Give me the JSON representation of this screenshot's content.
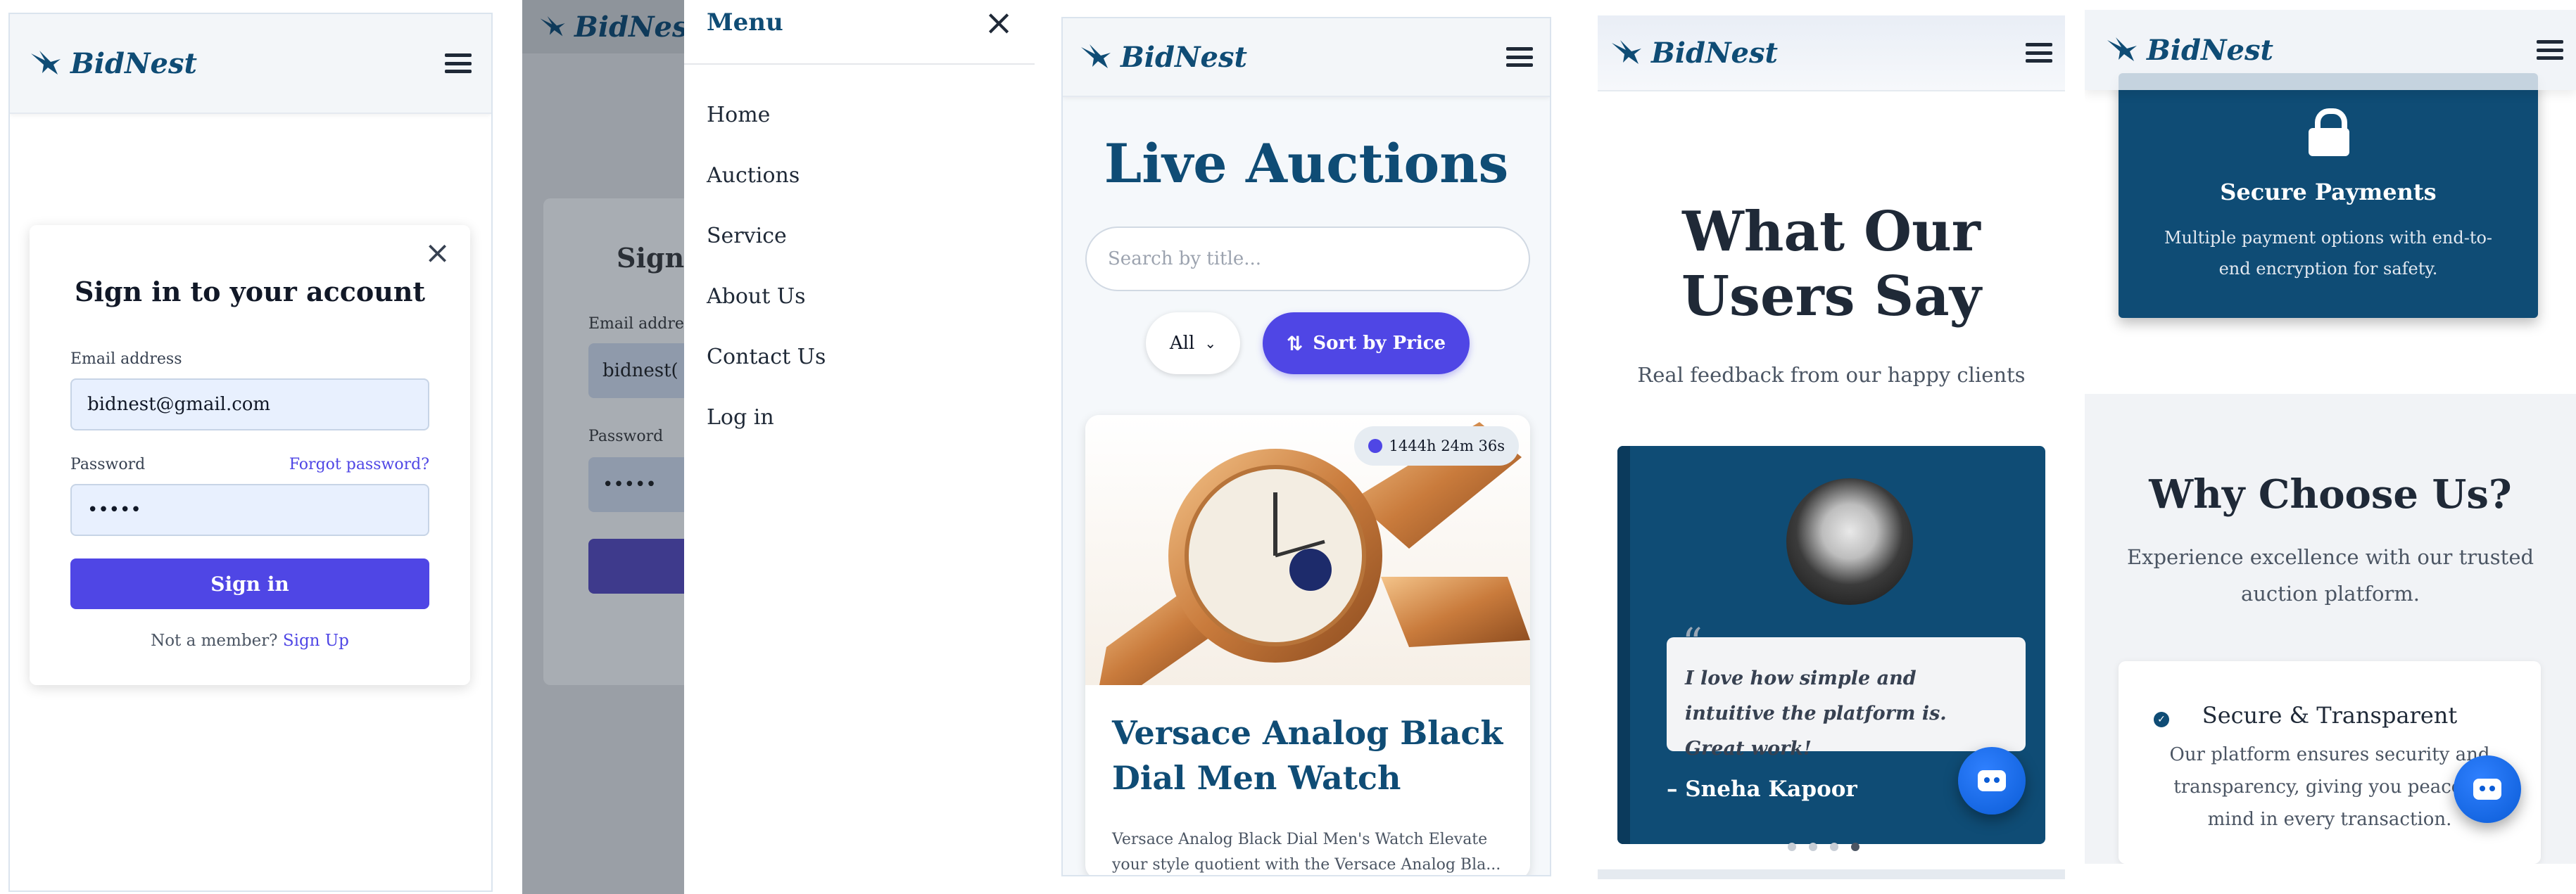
{
  "brand": {
    "name": "BidNest"
  },
  "signin": {
    "title": "Sign in to your account",
    "email_label": "Email address",
    "email_value": "bidnest@gmail.com",
    "password_label": "Password",
    "forgot": "Forgot password?",
    "password_value": "•••••",
    "submit": "Sign in",
    "member_text": "Not a member?",
    "signup": "Sign Up"
  },
  "menu": {
    "title": "Menu",
    "items": [
      "Home",
      "Auctions",
      "Service",
      "About Us",
      "Contact Us",
      "Log in"
    ],
    "bg_partial": {
      "title": "Sign",
      "email_label": "Email addre",
      "email_value": "bidnest(",
      "password_label": "Password",
      "password_value": "•••••"
    }
  },
  "auctions": {
    "title": "Live Auctions",
    "search_placeholder": "Search by title...",
    "filter_value": "All",
    "sort_button": "Sort by Price",
    "timer": "1444h 24m 36s",
    "item_title": "Versace Analog Black Dial Men Watch",
    "item_desc": "Versace Analog Black Dial Men's Watch Elevate your style quotient with the Versace Analog Bla..."
  },
  "testimonials": {
    "title": "What Our Users Say",
    "subtitle": "Real feedback from our happy clients",
    "quote": "I love how simple and intuitive the platform is. Great work!",
    "author": "– Sneha Kapoor"
  },
  "why": {
    "payments_title": "Secure Payments",
    "payments_desc": "Multiple payment options with end-to-end encryption for safety.",
    "title": "Why Choose Us?",
    "subtitle": "Experience excellence with our trusted auction platform.",
    "card_title": "Secure & Transparent",
    "card_desc": "Our platform ensures security and transparency, giving you peace of mind in every transaction."
  },
  "colors": {
    "navy": "#0f4c75",
    "indigo": "#4f46e5",
    "input_bg": "#e8f0fe"
  }
}
